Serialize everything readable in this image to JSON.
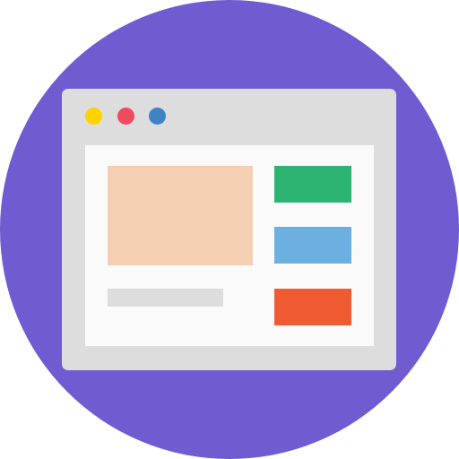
{
  "colors": {
    "background_circle": "#715BD1",
    "window_frame": "#DDDDDD",
    "window_content": "#FAFAFA",
    "dot_yellow": "#FFD200",
    "dot_red": "#EF4A5E",
    "dot_blue": "#3F83C6",
    "image_placeholder": "#F5CFB3",
    "text_placeholder": "#DDDDDD",
    "block_green": "#2DB473",
    "block_blue": "#6BB0E0",
    "block_orange": "#F05A32"
  },
  "icons": {
    "illustration": "browser-window-icon"
  }
}
